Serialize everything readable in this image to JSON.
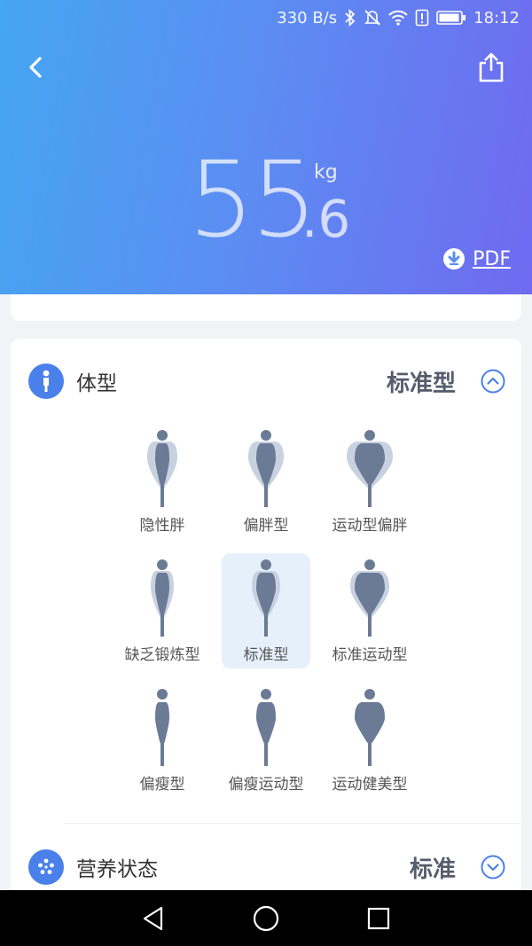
{
  "status_bar": {
    "net_speed": "330 B/s",
    "time": "18:12",
    "icons": [
      "bluetooth-icon",
      "mute-icon",
      "wifi-icon",
      "alert-icon",
      "battery-icon"
    ]
  },
  "header": {
    "weight_integer": "55",
    "weight_decimal": ".6",
    "weight_unit": "kg",
    "pdf_label": "PDF",
    "colors": {
      "gradient_start": "#45a6f2",
      "gradient_end": "#6f6af0"
    }
  },
  "body_type": {
    "title": "体型",
    "value": "标准型",
    "selected_index": 4,
    "types": [
      {
        "label": "隐性胖",
        "shape": "slim-shadow-wide"
      },
      {
        "label": "偏胖型",
        "shape": "medium-shadow-wide"
      },
      {
        "label": "运动型偏胖",
        "shape": "wide-shadow-wide"
      },
      {
        "label": "缺乏锻炼型",
        "shape": "slim-shadow-medium"
      },
      {
        "label": "标准型",
        "shape": "medium-shadow-medium"
      },
      {
        "label": "标准运动型",
        "shape": "wide-shadow-medium"
      },
      {
        "label": "偏瘦型",
        "shape": "slim-shadow-thin"
      },
      {
        "label": "偏瘦运动型",
        "shape": "medium-shadow-thin"
      },
      {
        "label": "运动健美型",
        "shape": "wide-shadow-thin"
      }
    ]
  },
  "nutrition": {
    "title": "营养状态",
    "value": "标准"
  },
  "accent_color": "#4a80ea"
}
